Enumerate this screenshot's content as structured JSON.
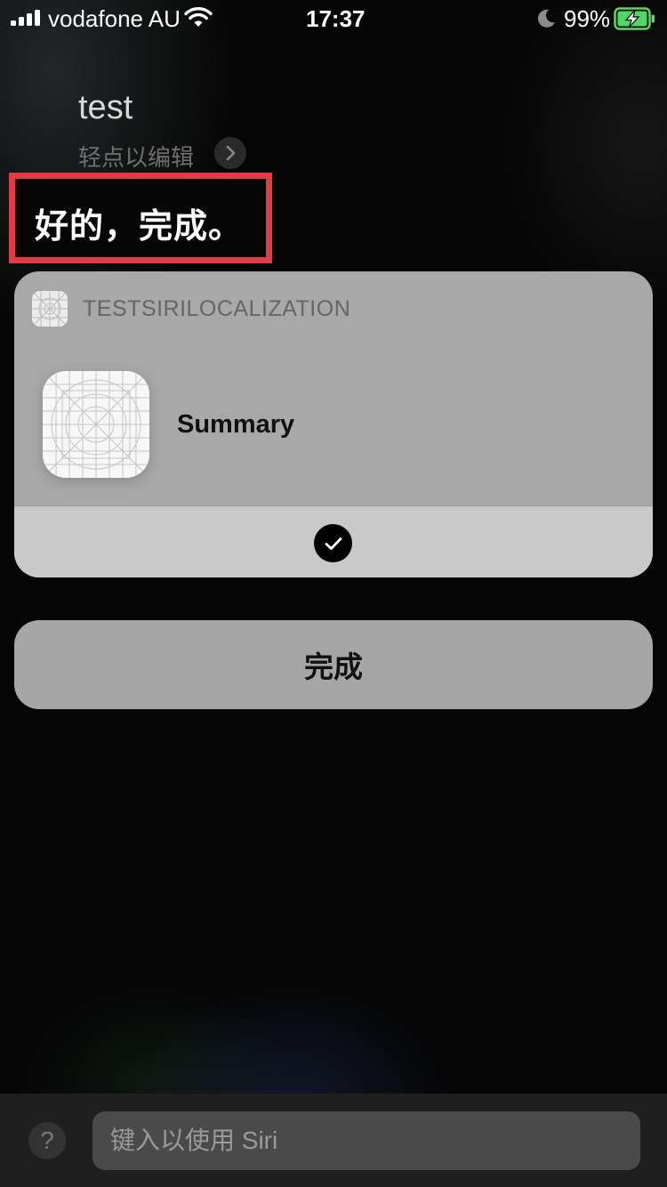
{
  "status_bar": {
    "carrier": "vodafone AU",
    "time": "17:37",
    "battery_percent": "99%",
    "icons": [
      "signal-icon",
      "wifi-icon",
      "moon-icon",
      "battery-charging-icon"
    ]
  },
  "siri": {
    "query": "test",
    "edit_hint": "轻点以编辑",
    "response": "好的，完成。"
  },
  "card": {
    "app_name": "TESTSIRILOCALIZATION",
    "item_title": "Summary",
    "confirmed": true
  },
  "done_button": {
    "label": "完成"
  },
  "input": {
    "placeholder": "键入以使用 Siri",
    "help_label": "?"
  },
  "colors": {
    "highlight_border": "#e23b43",
    "card_bg": "#a8a8a8",
    "confirm_row_bg": "#c9c9ca"
  }
}
